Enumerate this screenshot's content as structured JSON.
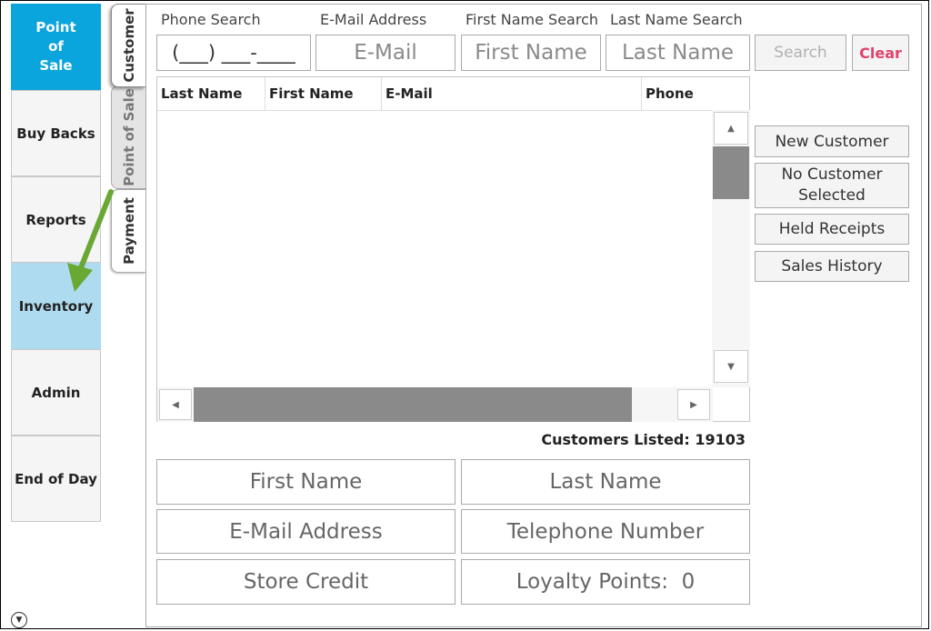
{
  "nav": {
    "point_of_sale": "Point\nof\nSale",
    "buy_backs": "Buy Backs",
    "reports": "Reports",
    "inventory": "Inventory",
    "admin": "Admin",
    "end_of_day": "End of Day"
  },
  "tabs": {
    "customer": "Customer",
    "point_of_sale": "Point of Sale",
    "payment": "Payment"
  },
  "search": {
    "phone_label": "Phone Search",
    "email_label": "E-Mail Address",
    "first_label": "First Name Search",
    "last_label": "Last Name Search",
    "phone_placeholder": "(___) ___-____",
    "email_placeholder": "E-Mail",
    "first_placeholder": "First Name",
    "last_placeholder": "Last Name",
    "search_button": "Search",
    "clear_button": "Clear"
  },
  "grid": {
    "columns": [
      "Last Name",
      "First Name",
      "E-Mail",
      "Phone"
    ],
    "rows": []
  },
  "actions": {
    "new_customer": "New Customer",
    "no_customer": "No Customer Selected",
    "held_receipts": "Held Receipts",
    "sales_history": "Sales History"
  },
  "status": {
    "customers_listed": "Customers Listed: 19103"
  },
  "details": {
    "first_name": "First Name",
    "last_name": "Last Name",
    "email": "E-Mail Address",
    "telephone": "Telephone Number",
    "store_credit": "Store Credit",
    "loyalty_points": "Loyalty Points:  0"
  },
  "colors": {
    "accent": "#0aa5dc",
    "inventory_highlight": "#aedbef",
    "clear_text": "#e0436b",
    "arrow": "#6aa834"
  },
  "icons": {
    "arrow": "green-arrow",
    "collapse": "chevron-down-circle-icon"
  }
}
